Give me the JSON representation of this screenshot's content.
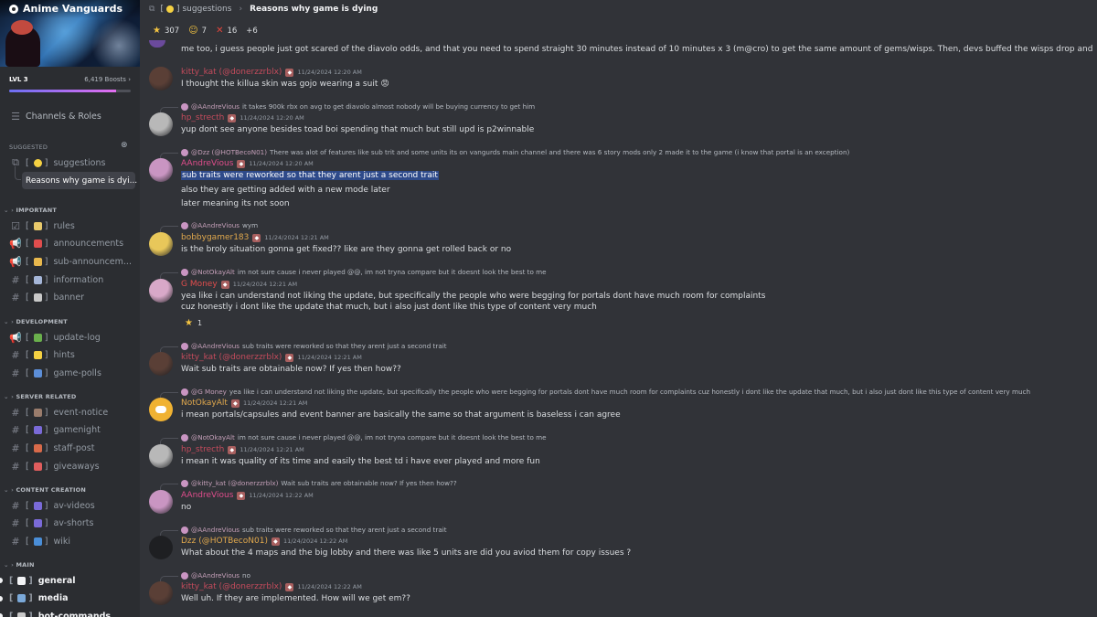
{
  "server": {
    "name": "Anime Vanguards",
    "level": "LVL 3",
    "boosts": "6,419 Boosts",
    "boost_chevron": "›"
  },
  "sidebar": {
    "channels_roles": "Channels & Roles",
    "suggested_label": "SUGGESTED",
    "suggested": [
      {
        "label": "suggestions",
        "icon": "thread-icon"
      },
      {
        "label": "Reasons why game is dyi...",
        "icon": "thread-child"
      }
    ],
    "categories": [
      {
        "name": "IMPORTANT",
        "channels": [
          {
            "label": "rules",
            "icon": "rules-icon",
            "emoji_color": "#e8c96b"
          },
          {
            "label": "announcements",
            "icon": "megaphone-icon",
            "emoji_color": "#e04d4d"
          },
          {
            "label": "sub-announcem...",
            "icon": "megaphone-icon",
            "emoji_color": "#e8b84d"
          },
          {
            "label": "information",
            "icon": "hash-icon",
            "emoji_color": "#a5b6d8"
          },
          {
            "label": "banner",
            "icon": "hash-icon",
            "emoji_color": "#c9c9c9"
          }
        ]
      },
      {
        "name": "DEVELOPMENT",
        "channels": [
          {
            "label": "update-log",
            "icon": "megaphone-icon",
            "emoji_color": "#6ab04c"
          },
          {
            "label": "hints",
            "icon": "hash-icon",
            "emoji_color": "#f5d142"
          },
          {
            "label": "game-polls",
            "icon": "hash-icon",
            "emoji_color": "#5c8ed8"
          }
        ]
      },
      {
        "name": "SERVER RELATED",
        "channels": [
          {
            "label": "event-notice",
            "icon": "hash-icon",
            "emoji_color": "#9a7c6c"
          },
          {
            "label": "gamenight",
            "icon": "hash-icon",
            "emoji_color": "#7a6ad8"
          },
          {
            "label": "staff-post",
            "icon": "hash-icon",
            "emoji_color": "#d86a4a"
          },
          {
            "label": "giveaways",
            "icon": "hash-icon",
            "emoji_color": "#e05d5d"
          }
        ]
      },
      {
        "name": "CONTENT CREATION",
        "channels": [
          {
            "label": "av-videos",
            "icon": "hash-icon",
            "emoji_color": "#7a6ad8"
          },
          {
            "label": "av-shorts",
            "icon": "hash-icon",
            "emoji_color": "#7a6ad8"
          },
          {
            "label": "wiki",
            "icon": "hash-icon",
            "emoji_color": "#4a8ed8"
          }
        ]
      },
      {
        "name": "MAIN",
        "channels": [
          {
            "label": "general",
            "icon": "bracket",
            "emoji_color": "#f2f3f5",
            "bold": true
          },
          {
            "label": "media",
            "icon": "bracket",
            "emoji_color": "#7aa8d8",
            "bold": true
          },
          {
            "label": "bot-commands",
            "icon": "bracket",
            "emoji_color": "#c9c9c9",
            "bold": true
          }
        ]
      }
    ]
  },
  "topbar": {
    "channel": "suggestions",
    "thread": "Reasons why game is dying",
    "separator": "›"
  },
  "reactions": [
    {
      "emoji": "★",
      "count": "307"
    },
    {
      "emoji": "☺",
      "count": "7"
    },
    {
      "emoji": "✕",
      "count": "16"
    },
    {
      "emoji": "",
      "count": "+6"
    }
  ],
  "messages": [
    {
      "type": "cont",
      "text": "me too, i guess people just got scared of the diavolo odds, and that you need to spend straight 30 minutes instead of 10 minutes x 3 (m@cro) to get the same amount of gems/wisps. Then, devs buffed the wisps drop and tbh its great a"
    },
    {
      "type": "msg",
      "author": "kitty_kat (@donerzzrblx)",
      "author_color": "#c44b5c",
      "time": "11/24/2024 12:20 AM",
      "lines": [
        "I thought the killua skin was gojo wearing a suit"
      ]
    },
    {
      "type": "msg",
      "ref_name": "@AAndreVious",
      "ref_text": "it takes 900k rbx on avg to get diavolo almost nobody will be buying currency to get him",
      "author": "hp_strecth",
      "author_color": "#c44b5c",
      "time": "11/24/2024 12:20 AM",
      "lines": [
        "yup dont see anyone besides toad boi spending that much but still upd is p2winnable"
      ]
    },
    {
      "type": "msg",
      "ref_name": "@Dzz (@HOTBecoN01)",
      "ref_text": "There was alot of features like sub trit and some units its  on vangurds main channel and there was 6 story mods only 2 made it to the game (i know that portal is an exception)",
      "author": "AAndreVious",
      "author_color": "#e04d8c",
      "time": "11/24/2024 12:20 AM",
      "lines": [
        "sub traits were reworked so that they arent just a second trait",
        "also they are getting added with a new mode later",
        "later meaning its not soon"
      ]
    },
    {
      "type": "msg",
      "ref_name": "@AAndreVious",
      "ref_text": "wym",
      "author": "bobbygamer183",
      "author_color": "#e0a84d",
      "time": "11/24/2024 12:21 AM",
      "lines": [
        "is the broly situation gonna get fixed?? like are they gonna get rolled back or no"
      ]
    },
    {
      "type": "msg",
      "ref_name": "@NotOkayAlt",
      "ref_text": "im not sure cause i never played @@, im not tryna compare but it doesnt look the best to me",
      "author": "G Money",
      "author_color": "#e04d4d",
      "time": "11/24/2024 12:21 AM",
      "lines": [
        "yea like i can understand not liking the update, but specifically the people who were begging for portals dont have much room for complaints",
        "cuz honestly i dont like the update that much, but i also just dont like this type of content very much"
      ],
      "reaction": {
        "emoji": "★",
        "count": "1"
      }
    },
    {
      "type": "msg",
      "ref_name": "@AAndreVious",
      "ref_text": "sub traits were reworked so that they arent just a second trait",
      "author": "kitty_kat (@donerzzrblx)",
      "author_color": "#c44b5c",
      "time": "11/24/2024 12:21 AM",
      "lines": [
        "Wait sub traits are obtainable now? If yes then how??"
      ]
    },
    {
      "type": "msg",
      "ref_name": "@G Money",
      "ref_text": "yea like i can understand not liking the update, but specifically the people who were begging for portals dont have much room for complaints cuz honestly i dont like the update that much, but i also just dont like this type of content very much",
      "author": "NotOkayAlt",
      "author_color": "#e0a84d",
      "time": "11/24/2024 12:21 AM",
      "lines": [
        "i mean portals/capsules and event banner are basically the same so that argument is baseless i can agree"
      ]
    },
    {
      "type": "msg",
      "ref_name": "@NotOkayAlt",
      "ref_text": "im not sure cause i never played @@, im not tryna compare but it doesnt look the best to me",
      "author": "hp_strecth",
      "author_color": "#c44b5c",
      "time": "11/24/2024 12:21 AM",
      "lines": [
        "i mean it was quality of its time and easily the best td i have ever played and more fun"
      ]
    },
    {
      "type": "msg",
      "ref_name": "@kitty_kat (@donerzzrblx)",
      "ref_text": "Wait sub traits are obtainable now? If yes then how??",
      "author": "AAndreVious",
      "author_color": "#e04d8c",
      "time": "11/24/2024 12:22 AM",
      "lines": [
        "no"
      ]
    },
    {
      "type": "msg",
      "ref_name": "@AAndreVious",
      "ref_text": "sub traits were reworked so that they arent just a second trait",
      "author": "Dzz (@HOTBecoN01)",
      "author_color": "#e0a84d",
      "time": "11/24/2024 12:22 AM",
      "lines": [
        "What about the 4 maps and the big lobby  and there was like 5 units are did you aviod them for copy issues ?"
      ]
    },
    {
      "type": "msg",
      "ref_name": "@AAndreVious",
      "ref_text": "no",
      "author": "kitty_kat (@donerzzrblx)",
      "author_color": "#c44b5c",
      "time": "11/24/2024 12:22 AM",
      "lines": [
        "Well uh. If they are implemented. How will we get em??"
      ]
    }
  ],
  "colors": {
    "highlight": "#2e4a8a",
    "sidebar_bg": "#2b2d31",
    "main_bg": "#313338"
  }
}
